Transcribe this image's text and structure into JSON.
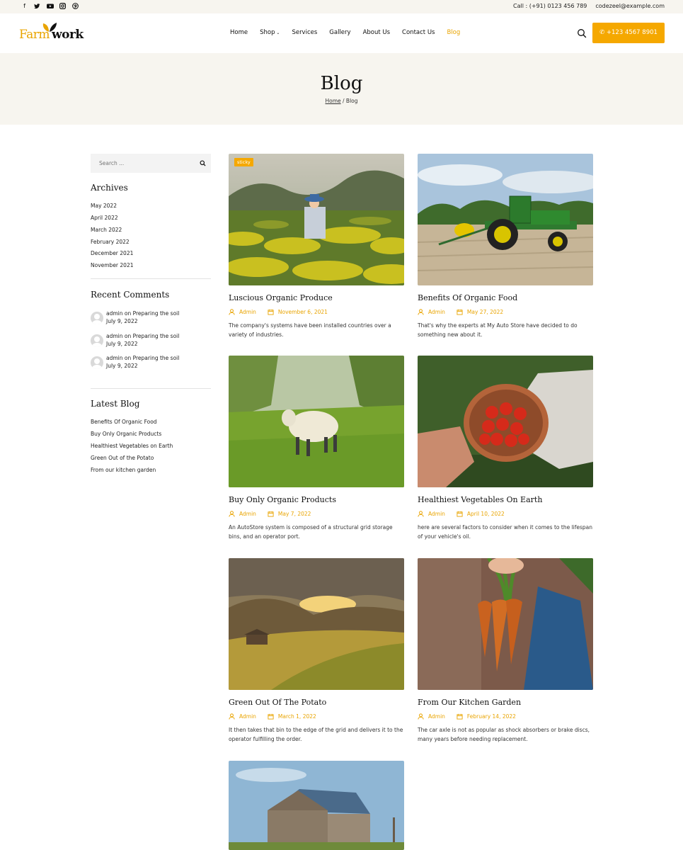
{
  "topbar": {
    "social_icons": [
      "facebook-icon",
      "twitter-icon",
      "youtube-icon",
      "instagram-icon",
      "pinterest-icon"
    ],
    "call": "Call : (+91) 0123 456 789",
    "email": "codezeel@example.com"
  },
  "header": {
    "logo_farm": "Farm",
    "logo_work": "work",
    "nav": [
      "Home",
      "Shop",
      "Services",
      "Gallery",
      "About Us",
      "Contact Us",
      "Blog"
    ],
    "active_nav": "Blog",
    "phone_button": "+123 4567 8901"
  },
  "banner": {
    "title": "Blog",
    "crumb_home": "Home",
    "crumb_sep": " / ",
    "crumb_current": "Blog"
  },
  "sidebar": {
    "search_placeholder": "Search ...",
    "archives_title": "Archives",
    "archives": [
      "May 2022",
      "April 2022",
      "March 2022",
      "February 2022",
      "December 2021",
      "November 2021"
    ],
    "comments_title": "Recent Comments",
    "comments": [
      {
        "author": "admin",
        "on": "on",
        "post": "Preparing the soil",
        "date": "July 9, 2022"
      },
      {
        "author": "admin",
        "on": "on",
        "post": "Preparing the soil",
        "date": "July 9, 2022"
      },
      {
        "author": "admin",
        "on": "on",
        "post": "Preparing the soil",
        "date": "July 9, 2022"
      }
    ],
    "latest_title": "Latest Blog",
    "latest": [
      "Benefits Of Organic Food",
      "Buy Only Organic Products",
      "Healthiest Vegetables on Earth",
      "Green Out of the Potato",
      "From our kitchen garden"
    ]
  },
  "posts": [
    {
      "title": "Luscious Organic Produce",
      "author": "Admin",
      "date": "November 6, 2021",
      "excerpt": "The company's systems have been installed countries over a variety of industries.",
      "badge": "sticky"
    },
    {
      "title": "Benefits Of Organic Food",
      "author": "Admin",
      "date": "May 27, 2022",
      "excerpt": "That's why the experts at My Auto Store have decided to do something new about it."
    },
    {
      "title": "Buy Only Organic Products",
      "author": "Admin",
      "date": "May 7, 2022",
      "excerpt": "An AutoStore system is composed of a structural grid storage bins, and an operator port."
    },
    {
      "title": "Healthiest Vegetables On Earth",
      "author": "Admin",
      "date": "April 10, 2022",
      "excerpt": "here are several factors to consider when it comes to the lifespan of your vehicle's oil."
    },
    {
      "title": "Green Out Of The Potato",
      "author": "Admin",
      "date": "March 1, 2022",
      "excerpt": "It then takes that bin to the edge of the grid and delivers it to the operator fulfilling the order."
    },
    {
      "title": "From Our Kitchen Garden",
      "author": "Admin",
      "date": "February 14, 2022",
      "excerpt": "The car axle is not as popular as shock absorbers or brake discs, many years before needing replacement."
    }
  ],
  "colors": {
    "accent": "#f5a800",
    "band": "#f7f5ef"
  }
}
